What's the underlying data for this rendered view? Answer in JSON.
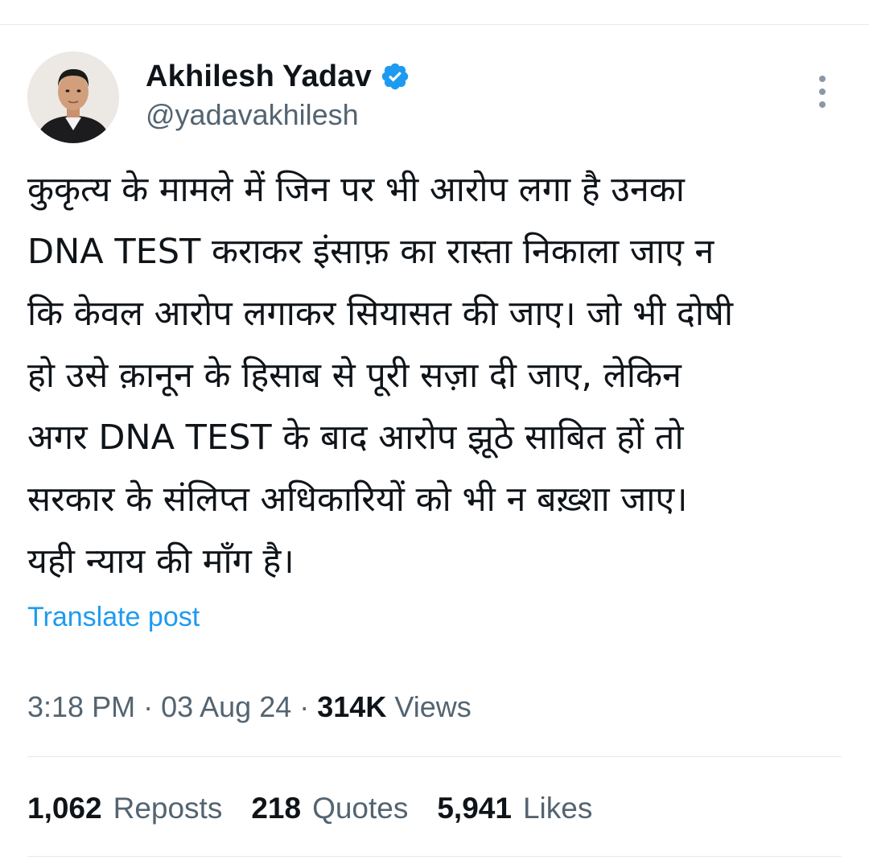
{
  "author": {
    "display_name": "Akhilesh Yadav",
    "handle": "@yadavakhilesh",
    "avatar_icon": "profile-photo",
    "verified_icon": "verified-badge-icon",
    "verified_color": "#1d9bf0"
  },
  "tweet": {
    "lines": [
      "कुकृत्य के मामले में जिन पर भी आरोप लगा है उनका",
      "DNA TEST कराकर इंसाफ़ का रास्ता निकाला जाए न",
      "कि केवल आरोप लगाकर सियासत की जाए। जो भी दोषी",
      "हो उसे क़ानून के हिसाब से पूरी सज़ा दी जाए, लेकिन",
      "अगर DNA TEST के बाद आरोप झूठे साबित हों तो",
      "सरकार के संलिप्त अधिकारियों को भी न बख़्शा जाए।",
      "यही न्याय की माँग है।"
    ],
    "translate_label": "Translate post"
  },
  "meta": {
    "time": "3:18 PM",
    "separator": "·",
    "date": "03 Aug 24",
    "views_count": "314K",
    "views_label": "Views"
  },
  "stats": {
    "reposts_count": "1,062",
    "reposts_label": "Reposts",
    "quotes_count": "218",
    "quotes_label": "Quotes",
    "likes_count": "5,941",
    "likes_label": "Likes"
  },
  "colors": {
    "text_primary": "#0f1419",
    "text_secondary": "#536471",
    "link": "#1d9bf0",
    "divider": "#e6e9ec"
  }
}
